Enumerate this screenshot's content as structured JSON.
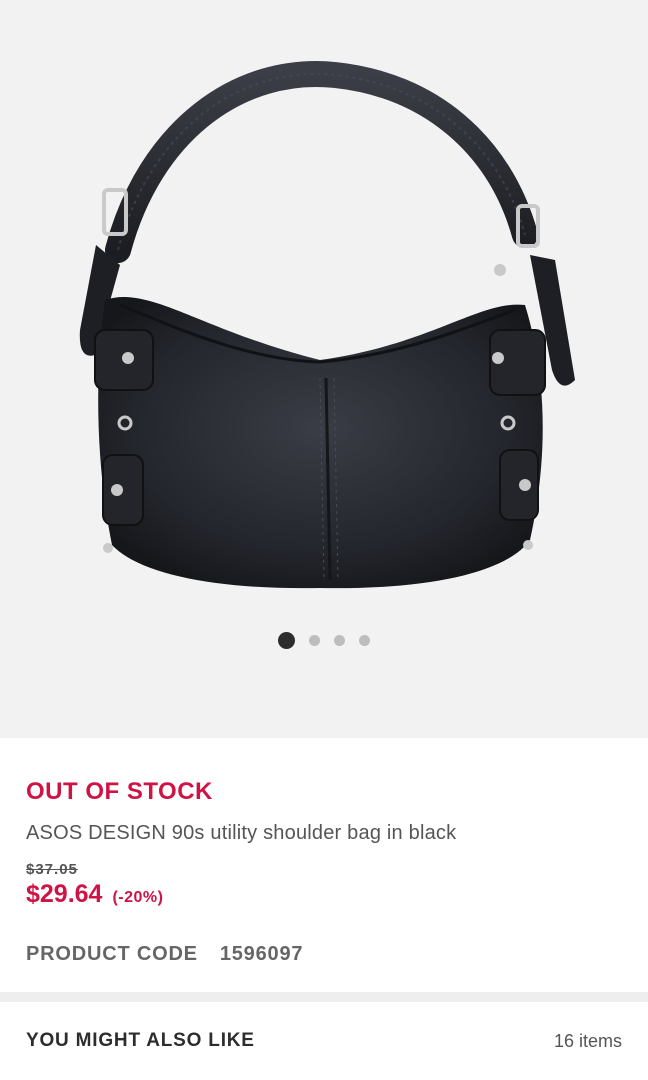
{
  "colors": {
    "accent": "#d01345",
    "text": "#2d2d2d",
    "muted": "#666666",
    "hero_bg": "#f2f2f2"
  },
  "gallery": {
    "image_icon": "black-shoulder-bag-photo",
    "total_images": 4,
    "active_index": 0
  },
  "product": {
    "stock_status": "OUT OF STOCK",
    "title": "ASOS DESIGN 90s utility shoulder bag in black",
    "was_price": "$37.05",
    "price": "$29.64",
    "discount": "(-20%)",
    "code_label": "PRODUCT CODE",
    "code_value": "1596097"
  },
  "recommendations": {
    "title": "YOU MIGHT ALSO LIKE",
    "count": "16 items"
  }
}
